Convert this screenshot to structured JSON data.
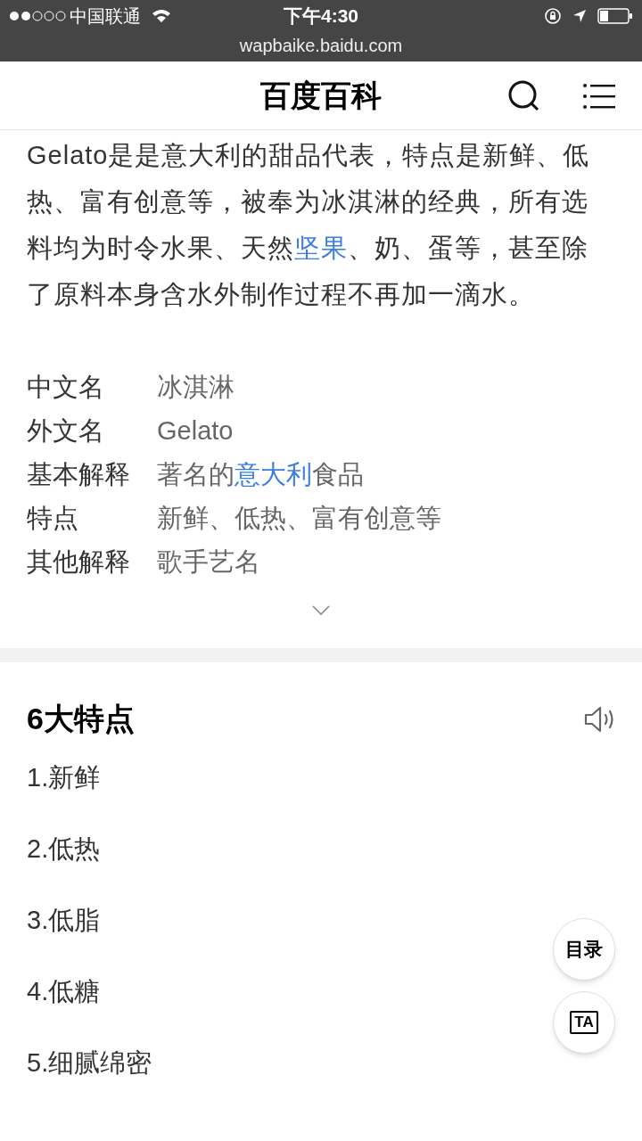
{
  "status_bar": {
    "carrier": "中国联通",
    "time": "下午4:30",
    "url": "wapbaike.baidu.com"
  },
  "header": {
    "title": "百度百科"
  },
  "intro": [
    {
      "text": "Gelato是是意大利的甜品代表，特点是新鲜、低热、富有创意等，被奉为冰淇淋的经典，所有选料均为时令水果、天然",
      "link": false
    },
    {
      "text": "坚果",
      "link": true
    },
    {
      "text": "、奶、蛋等，甚至除了原料本身含水外制作过程不再加一滴水。",
      "link": false
    }
  ],
  "info": [
    {
      "label": "中文名",
      "value": [
        {
          "text": "冰淇淋",
          "link": false
        }
      ]
    },
    {
      "label": "外文名",
      "value": [
        {
          "text": "Gelato",
          "link": false
        }
      ]
    },
    {
      "label": "基本解释",
      "value": [
        {
          "text": "著名的",
          "link": false
        },
        {
          "text": "意大利",
          "link": true
        },
        {
          "text": "食品",
          "link": false
        }
      ]
    },
    {
      "label": "特点",
      "value": [
        {
          "text": "新鲜、低热、富有创意等",
          "link": false
        }
      ]
    },
    {
      "label": "其他解释",
      "value": [
        {
          "text": "歌手艺名",
          "link": false
        }
      ]
    }
  ],
  "section": {
    "title": "6大特点",
    "items": [
      "1.新鲜",
      "2.低热",
      "3.低脂",
      "4.低糖",
      "5.细腻绵密"
    ]
  },
  "floating": {
    "toc": "目录",
    "ta_icon_text": "TA"
  }
}
